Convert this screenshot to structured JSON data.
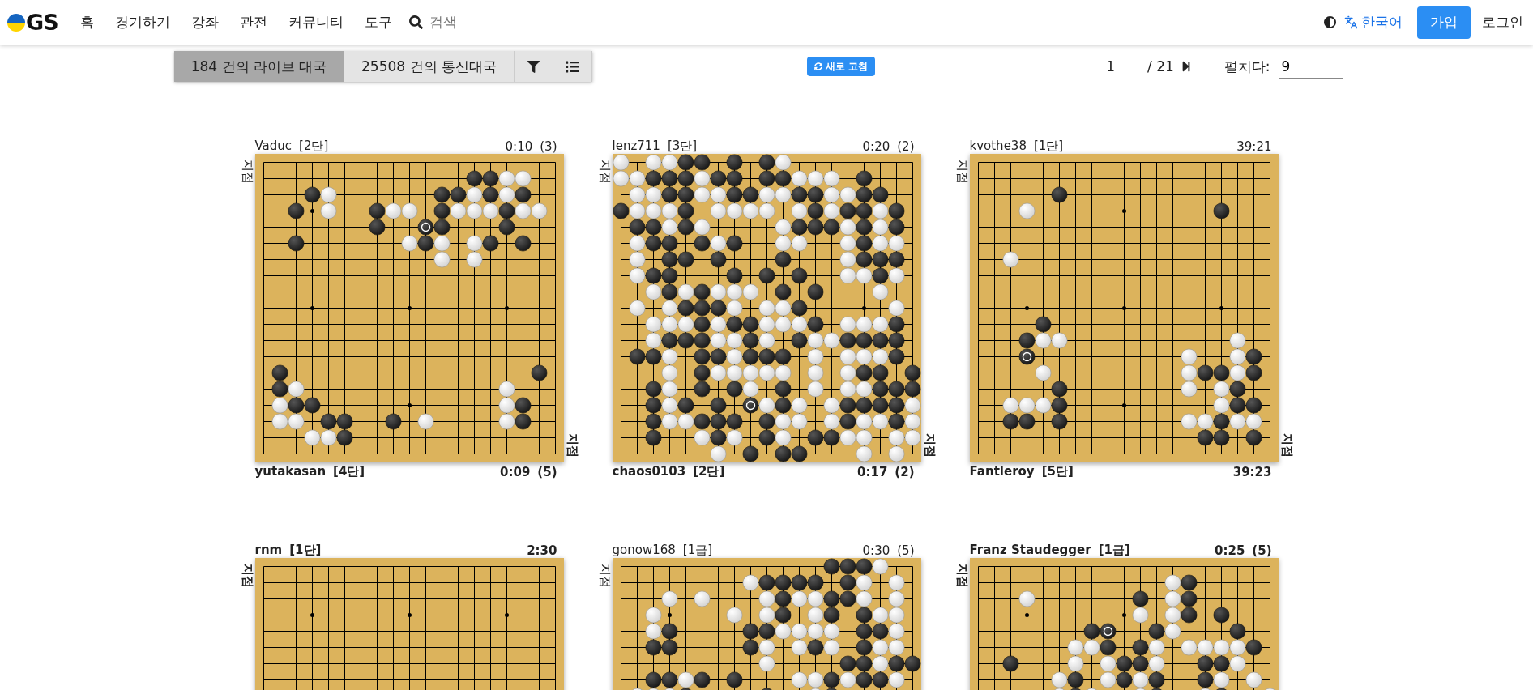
{
  "header": {
    "logo": "GS",
    "nav": [
      "홈",
      "경기하기",
      "강좌",
      "관전",
      "커뮤니티",
      "도구"
    ],
    "search": {
      "placeholder": "검색"
    },
    "language": "한국어",
    "signup": "가입",
    "login": "로그인"
  },
  "toolbar": {
    "tabs": [
      {
        "label": "184 건의 라이브 대국",
        "selected": true
      },
      {
        "label": "25508 건의 통신대국",
        "selected": false
      }
    ],
    "refresh": "새로 고침",
    "page": {
      "current": "1",
      "total": "/ 21"
    },
    "per_page": {
      "label": "펼치다:",
      "value": "9"
    }
  },
  "games": [
    {
      "top": {
        "name": "Vaduc",
        "rank": "[2단]",
        "clock": "0:10",
        "periods": "(3)",
        "side": "지점",
        "to_move": false
      },
      "bottom": {
        "name": "yutakasan",
        "rank": "[4단]",
        "clock": "0:09",
        "periods": "(5)",
        "side": "지점",
        "to_move": true
      }
    },
    {
      "top": {
        "name": "lenz711",
        "rank": "[3단]",
        "clock": "0:20",
        "periods": "(2)",
        "side": "지점",
        "to_move": false
      },
      "bottom": {
        "name": "chaos0103",
        "rank": "[2단]",
        "clock": "0:17",
        "periods": "(2)",
        "side": "지점",
        "to_move": true
      }
    },
    {
      "top": {
        "name": "kvothe38",
        "rank": "[1단]",
        "clock": "39:21",
        "side": "지점",
        "to_move": false
      },
      "bottom": {
        "name": "Fantleroy",
        "rank": "[5단]",
        "clock": "39:23",
        "side": "지점",
        "to_move": true
      }
    },
    {
      "top": {
        "name": "rnm",
        "rank": "[1단]",
        "clock": "2:30",
        "side": "지점",
        "to_move": true
      }
    },
    {
      "top": {
        "name": "gonow168",
        "rank": "[1급]",
        "clock": "0:30",
        "periods": "(5)",
        "side": "지점",
        "to_move": false
      }
    },
    {
      "top": {
        "name": "Franz Staudegger",
        "rank": "[1급]",
        "clock": "0:25",
        "periods": "(5)",
        "side": "지점",
        "to_move": true
      }
    }
  ]
}
